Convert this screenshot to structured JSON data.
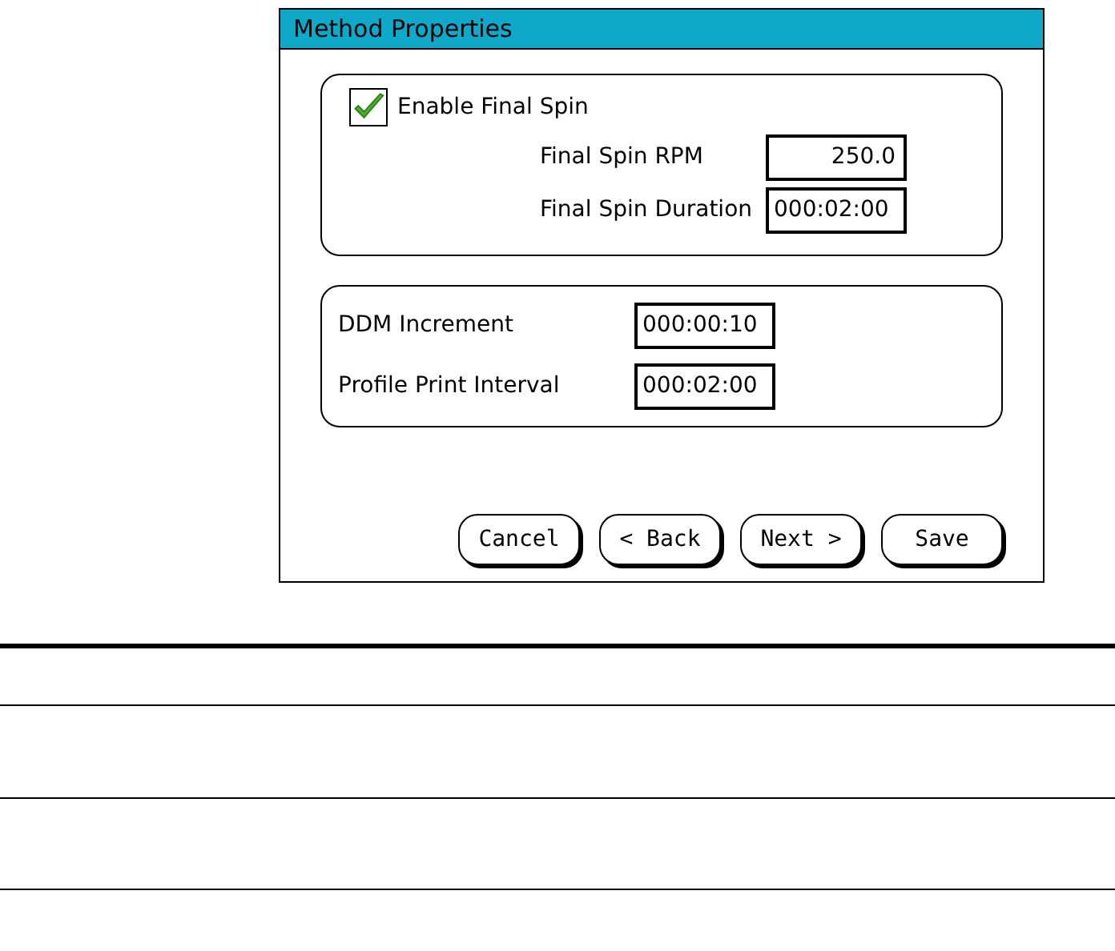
{
  "window": {
    "title": "Method Properties"
  },
  "final_spin": {
    "checkbox": {
      "label": "Enable Final Spin",
      "checked": true
    },
    "fields": [
      {
        "label": "Final Spin RPM",
        "value": "250.0"
      },
      {
        "label": "Final Spin Duration",
        "value": "000:02:00"
      }
    ]
  },
  "intervals": [
    {
      "label": "DDM Increment",
      "value": "000:00:10"
    },
    {
      "label": "Profile Print Interval",
      "value": "000:02:00"
    }
  ],
  "buttons": [
    "Cancel",
    "< Back",
    "Next >",
    "Save"
  ]
}
